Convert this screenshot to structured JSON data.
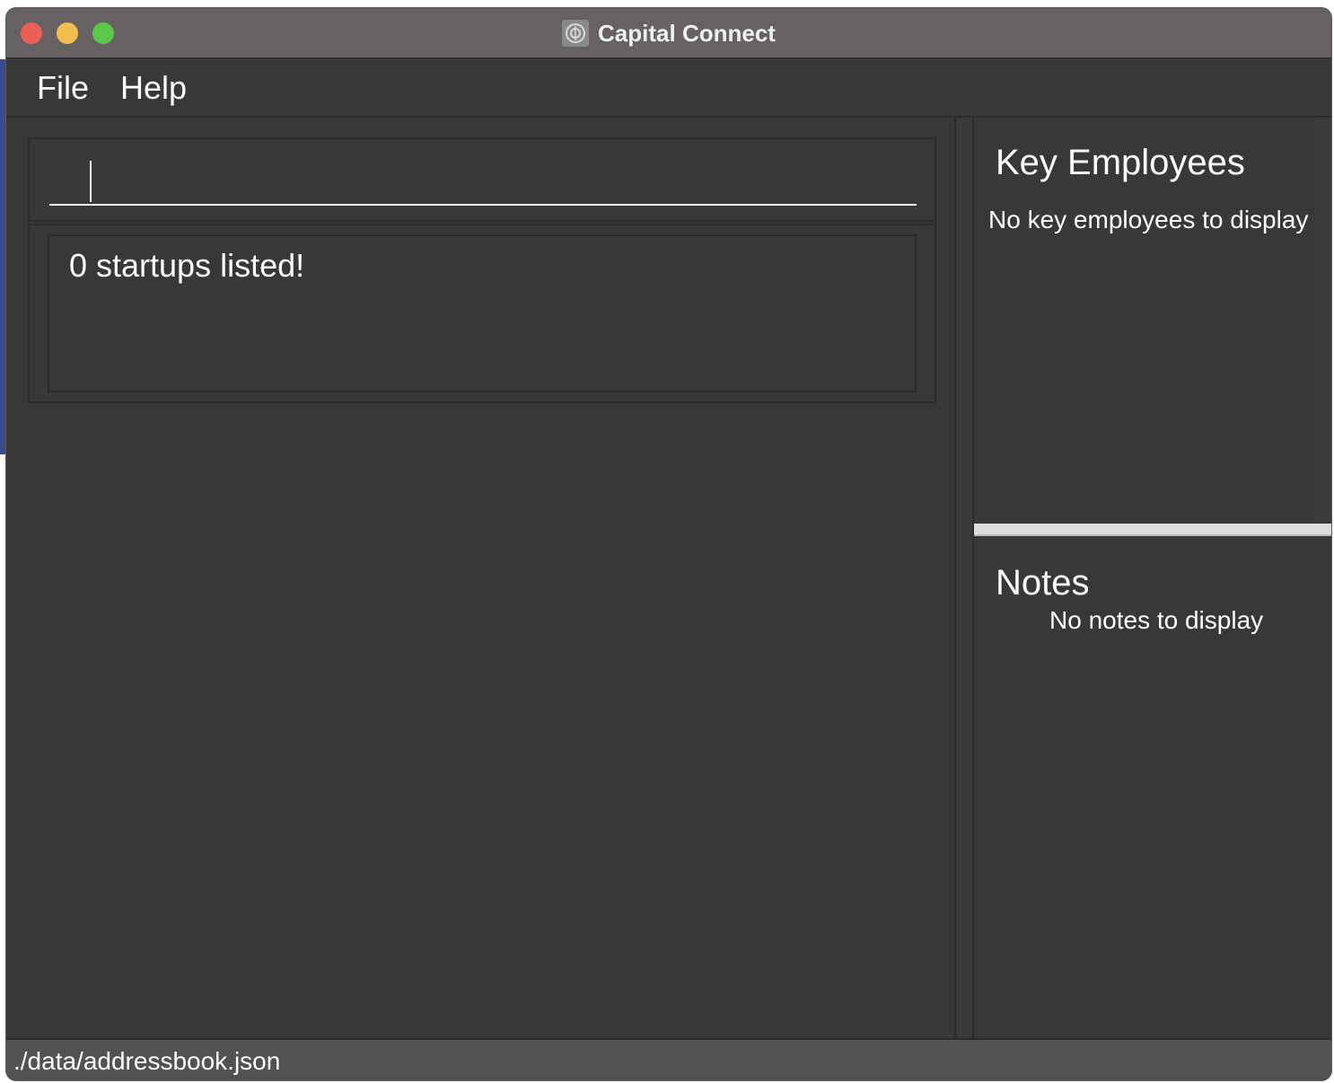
{
  "window": {
    "title": "Capital Connect"
  },
  "menu": {
    "file": "File",
    "help": "Help"
  },
  "command_box": {
    "value": "",
    "placeholder": ""
  },
  "result_display": {
    "message": "0 startups listed!"
  },
  "key_employees": {
    "title": "Key Employees",
    "empty_message": "No key employees to display"
  },
  "notes": {
    "title": "Notes",
    "empty_message": "No notes to display"
  },
  "status_bar": {
    "file_path": "./data/addressbook.json"
  },
  "colors": {
    "background": "#383838",
    "titlebar": "#676262",
    "text": "#ffffff",
    "divider": "#dcdcdc"
  },
  "icons": {
    "app": "capital-connect-logo-icon"
  }
}
